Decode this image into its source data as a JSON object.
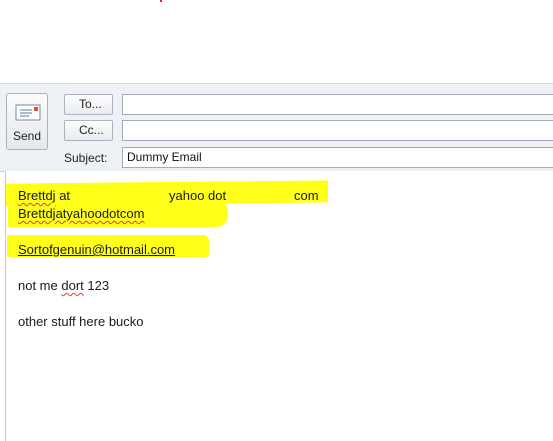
{
  "toolbar": {
    "send_label": "Send"
  },
  "recipients": {
    "to_label": "To...",
    "cc_label": "Cc...",
    "to_value": "",
    "cc_value": ""
  },
  "subject": {
    "label": "Subject:",
    "value": "Dummy Email"
  },
  "message": {
    "line1_part1": "Brettdj",
    "line1_part2": " at",
    "line1_part3": "yahoo dot",
    "line1_part4": "com",
    "line2": "Brettdjatyahoodotcom",
    "line3": "Sortofgenuin@hotmail.com",
    "line4_part1": "not me ",
    "line4_part2": "dort",
    "line4_part3": " 123",
    "line5": "other stuff here bucko"
  },
  "colors": {
    "highlight": "#ffff1a",
    "header_bg": "#eef2f7",
    "spellcheck": "#e23c3c"
  },
  "icons": {
    "send": "envelope-send-icon"
  }
}
